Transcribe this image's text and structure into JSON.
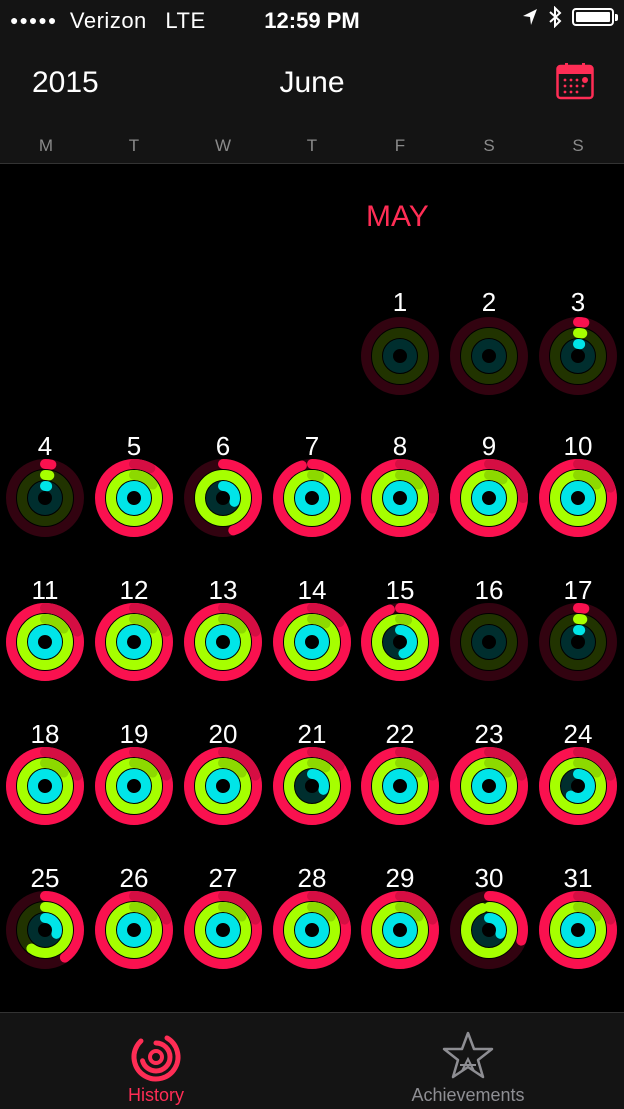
{
  "status_bar": {
    "signal": "●●●●●",
    "carrier": "Verizon",
    "network": "LTE",
    "time": "12:59 PM"
  },
  "header": {
    "year": "2015",
    "month": "June"
  },
  "weekdays": [
    "M",
    "T",
    "W",
    "T",
    "F",
    "S",
    "S"
  ],
  "calendar": {
    "month_label": "MAY",
    "days": [
      {
        "day": "1",
        "move": 0.0,
        "exercise": 0.0,
        "stand": 0.0
      },
      {
        "day": "2",
        "move": 0.0,
        "exercise": 0.0,
        "stand": 0.0
      },
      {
        "day": "3",
        "move": 0.03,
        "exercise": 0.03,
        "stand": 0.03
      },
      {
        "day": "4",
        "move": 0.03,
        "exercise": 0.03,
        "stand": 0.03
      },
      {
        "day": "5",
        "move": 1.08,
        "exercise": 1.15,
        "stand": 1.0
      },
      {
        "day": "6",
        "move": 0.45,
        "exercise": 1.0,
        "stand": 0.3
      },
      {
        "day": "7",
        "move": 0.95,
        "exercise": 1.05,
        "stand": 1.0
      },
      {
        "day": "8",
        "move": 1.3,
        "exercise": 1.15,
        "stand": 1.0
      },
      {
        "day": "9",
        "move": 1.25,
        "exercise": 1.1,
        "stand": 1.0
      },
      {
        "day": "10",
        "move": 1.2,
        "exercise": 1.15,
        "stand": 1.0
      },
      {
        "day": "11",
        "move": 1.2,
        "exercise": 1.15,
        "stand": 1.0
      },
      {
        "day": "12",
        "move": 1.2,
        "exercise": 1.15,
        "stand": 1.0
      },
      {
        "day": "13",
        "move": 1.2,
        "exercise": 1.15,
        "stand": 1.0
      },
      {
        "day": "14",
        "move": 1.15,
        "exercise": 1.1,
        "stand": 1.0
      },
      {
        "day": "15",
        "move": 0.95,
        "exercise": 1.05,
        "stand": 0.45
      },
      {
        "day": "16",
        "move": 0.0,
        "exercise": 0.0,
        "stand": 0.0
      },
      {
        "day": "17",
        "move": 0.03,
        "exercise": 0.03,
        "stand": 0.03
      },
      {
        "day": "18",
        "move": 1.2,
        "exercise": 1.15,
        "stand": 1.0
      },
      {
        "day": "19",
        "move": 1.2,
        "exercise": 1.15,
        "stand": 1.0
      },
      {
        "day": "20",
        "move": 1.2,
        "exercise": 1.15,
        "stand": 1.0
      },
      {
        "day": "21",
        "move": 1.15,
        "exercise": 1.1,
        "stand": 0.3
      },
      {
        "day": "22",
        "move": 1.2,
        "exercise": 1.15,
        "stand": 1.0
      },
      {
        "day": "23",
        "move": 1.2,
        "exercise": 1.15,
        "stand": 1.0
      },
      {
        "day": "24",
        "move": 1.2,
        "exercise": 1.15,
        "stand": 0.6
      },
      {
        "day": "25",
        "move": 0.4,
        "exercise": 0.6,
        "stand": 0.3
      },
      {
        "day": "26",
        "move": 1.2,
        "exercise": 1.15,
        "stand": 1.0
      },
      {
        "day": "27",
        "move": 1.2,
        "exercise": 1.15,
        "stand": 1.0
      },
      {
        "day": "28",
        "move": 1.2,
        "exercise": 1.15,
        "stand": 1.0
      },
      {
        "day": "29",
        "move": 1.2,
        "exercise": 1.15,
        "stand": 1.0
      },
      {
        "day": "30",
        "move": 0.3,
        "exercise": 0.95,
        "stand": 0.3
      },
      {
        "day": "31",
        "move": 1.2,
        "exercise": 1.15,
        "stand": 1.0
      }
    ]
  },
  "tab_bar": {
    "history_label": "History",
    "achievements_label": "Achievements"
  },
  "colors": {
    "accent": "#ff2d55",
    "move": "#fa114f",
    "exercise": "#a6ff00",
    "stand": "#00e5e8",
    "tab_inactive": "#8e8e93"
  },
  "icons": {
    "location": "location-arrow-icon",
    "bluetooth": "bluetooth-icon",
    "battery": "battery-icon",
    "calendar": "calendar-icon",
    "history": "activity-rings-icon",
    "achievements": "star-award-icon"
  }
}
